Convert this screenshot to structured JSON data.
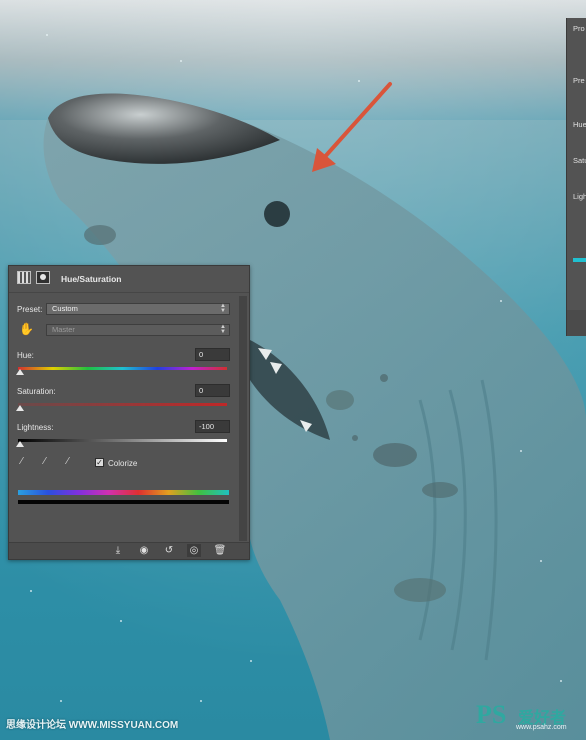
{
  "panel": {
    "title": "Hue/Saturation",
    "preset_label": "Preset:",
    "preset_value": "Custom",
    "channel_value": "Master",
    "hue_label": "Hue:",
    "hue_value": "0",
    "saturation_label": "Saturation:",
    "saturation_value": "0",
    "lightness_label": "Lightness:",
    "lightness_value": "-100",
    "colorize_label": "Colorize",
    "colorize_checked": true
  },
  "side_panel": {
    "labels": [
      "Pro",
      "Pre",
      "Hue",
      "Satu",
      "Ligh"
    ]
  },
  "watermark": {
    "left_text": "思缘设计论坛 WWW.MISSYUAN.COM",
    "right_logo": "PS",
    "right_text": "爱好者",
    "right_url": "www.psahz.com"
  },
  "colors": {
    "panel_bg": "#535353",
    "arrow": "#d9553a",
    "water": "#2d8ea6"
  }
}
